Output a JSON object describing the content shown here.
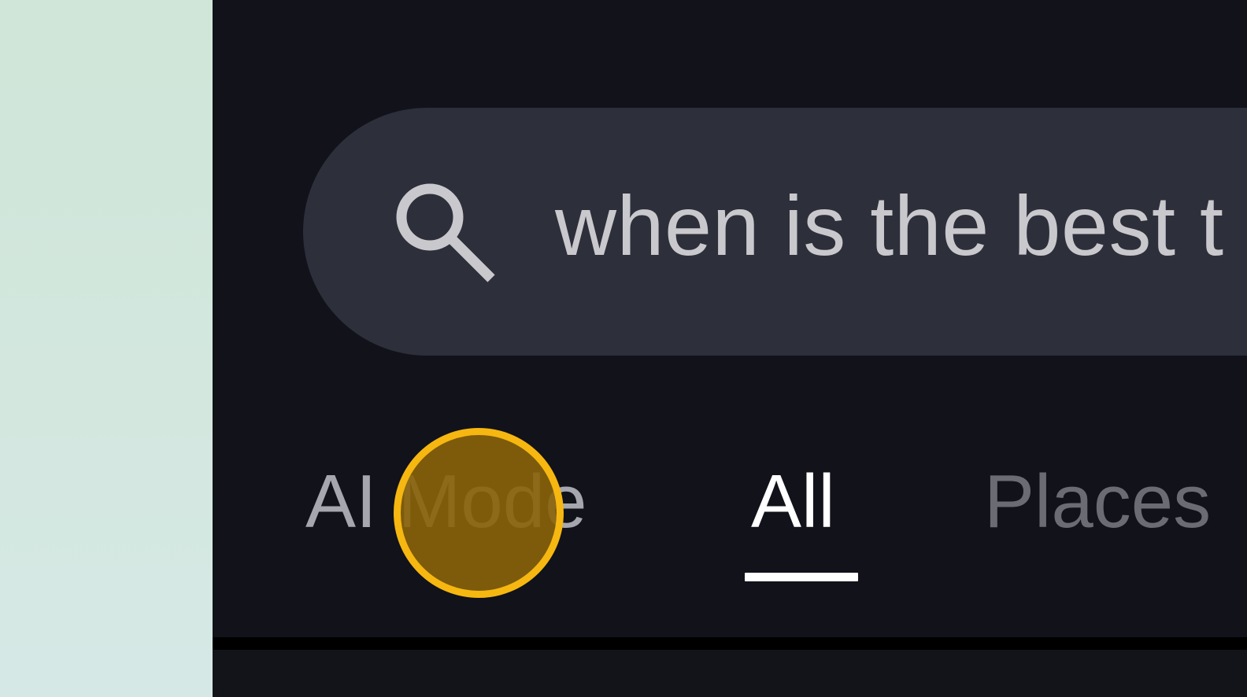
{
  "search": {
    "query": "when is the best t",
    "icon": "search-icon"
  },
  "tabs": [
    {
      "label": "AI Mode",
      "selected": false
    },
    {
      "label": "All",
      "selected": true
    },
    {
      "label": "Places",
      "selected": false
    }
  ],
  "colors": {
    "background_left": "#d3e8dd",
    "screen_background": "#11121a",
    "search_bar": "#2d2f3b",
    "query_text": "#c9c9cd",
    "tap_ring": "#f7b711",
    "tap_fill": "#89640a",
    "active_tab": "#ffffff"
  }
}
